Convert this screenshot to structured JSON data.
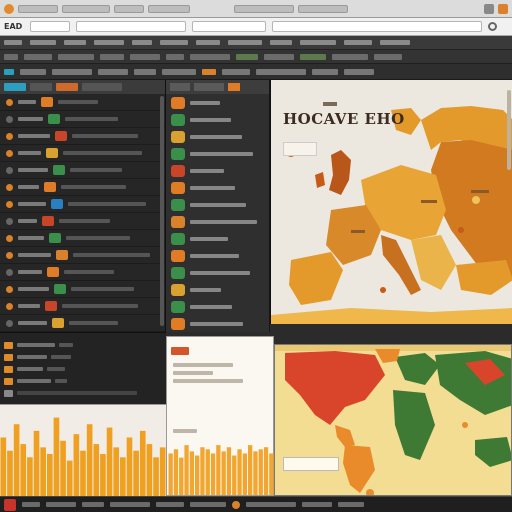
{
  "window": {
    "title_bar_items": [
      "",
      "",
      "",
      "",
      "",
      ""
    ],
    "app_label": "EAD",
    "address_fields": [
      "",
      "",
      "",
      ""
    ]
  },
  "menubar": {
    "items": [
      "",
      "",
      "",
      "",
      "",
      "",
      "",
      "",
      "",
      "",
      "",
      ""
    ]
  },
  "toolbar": {
    "items": [
      "",
      "",
      "",
      "",
      "",
      "",
      "",
      "",
      "",
      "",
      "",
      ""
    ]
  },
  "map_panel": {
    "title": "HOCAVE EHO",
    "colors": {
      "land_dark": "#c65a16",
      "land_mid": "#e39a2b",
      "land_light": "#f0b84a",
      "water": "#ece8df"
    }
  },
  "world_panel": {
    "colors": {
      "red": "#d8452b",
      "green": "#3e7a34",
      "yellow": "#f2c84b",
      "orange": "#e98b2a"
    }
  },
  "charts": {
    "left": {
      "type": "bar",
      "values": [
        18,
        14,
        22,
        16,
        12,
        20,
        15,
        13,
        24,
        17,
        11,
        19,
        14,
        22,
        16,
        13,
        21,
        15,
        12,
        18,
        14,
        20,
        16,
        12,
        15
      ]
    },
    "middle": {
      "type": "bar",
      "values": [
        20,
        22,
        18,
        24,
        21,
        19,
        23,
        22,
        20,
        24,
        21,
        23,
        19,
        22,
        20,
        24,
        21,
        22,
        23,
        20
      ]
    }
  }
}
